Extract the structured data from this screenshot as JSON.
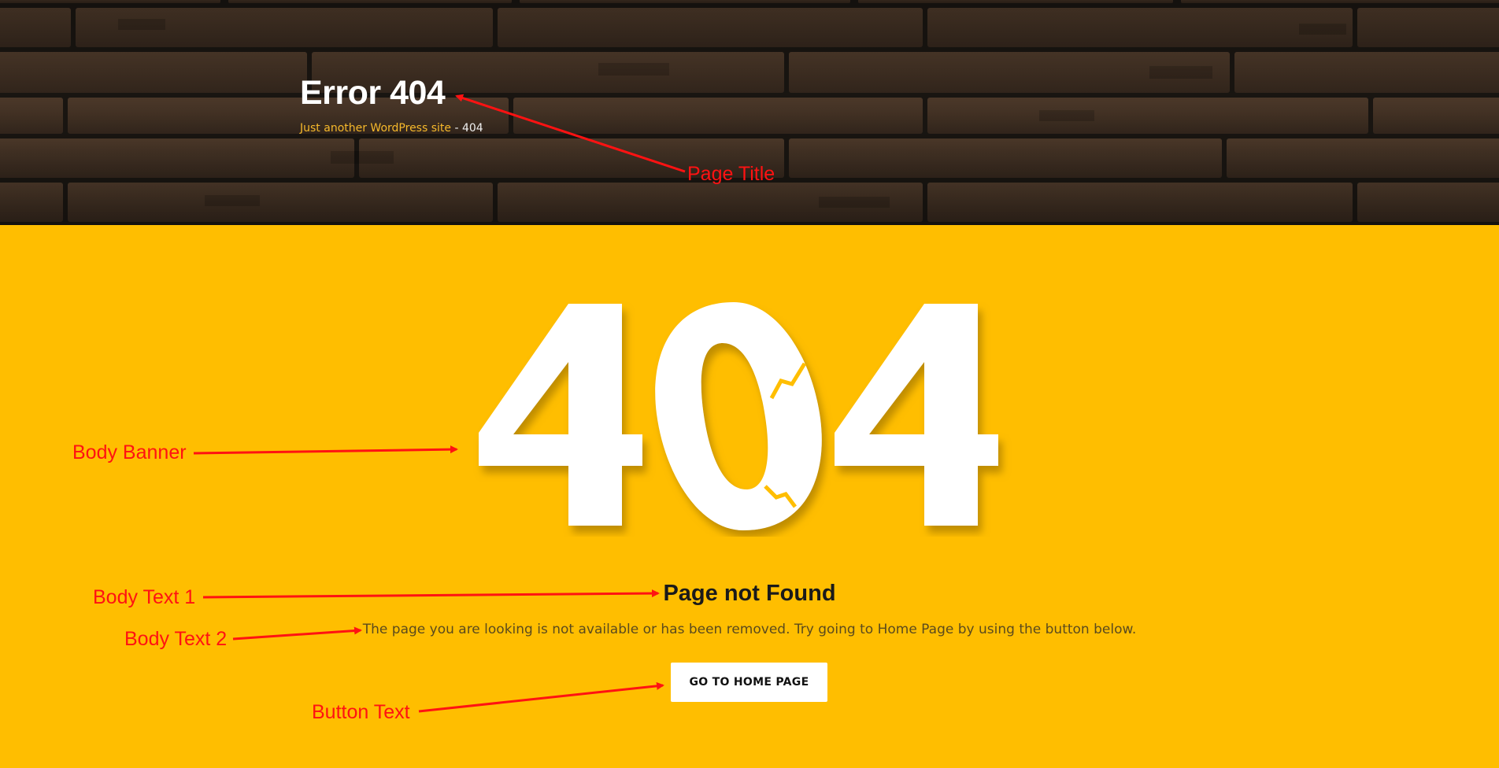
{
  "header": {
    "title": "Error 404",
    "breadcrumb": {
      "home_link": "Just another WordPress site",
      "separator": "-",
      "current": "404"
    }
  },
  "main": {
    "banner_text": "404",
    "heading": "Page not Found",
    "description": "The page you are looking is not available or has been removed. Try going to Home Page by using the button below.",
    "button_label": "GO TO HOME PAGE"
  },
  "annotations": {
    "page_title": "Page Title",
    "body_banner": "Body Banner",
    "body_text_1": "Body Text 1",
    "body_text_2": "Body Text 2",
    "button_text": "Button Text"
  },
  "colors": {
    "body_background": "#ffbe00",
    "breadcrumb_link": "#f7b92b",
    "annotation": "#ff1212",
    "button_background": "#ffffff"
  },
  "icons": [
    "brick-wall-background",
    "cracked-zero-banner",
    "annotation-arrow"
  ]
}
